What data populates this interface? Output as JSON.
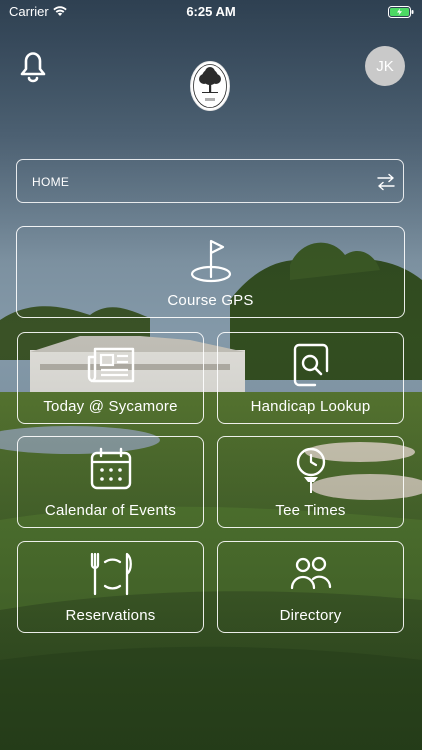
{
  "status_bar": {
    "carrier": "Carrier",
    "time": "6:25 AM"
  },
  "header": {
    "avatar_initials": "JK"
  },
  "selector": {
    "label": "HOME"
  },
  "tiles": {
    "course_gps": "Course GPS",
    "today": "Today @ Sycamore",
    "handicap": "Handicap Lookup",
    "calendar": "Calendar of Events",
    "tee_times": "Tee Times",
    "reservations": "Reservations",
    "directory": "Directory"
  },
  "colors": {
    "battery": "#4cd964",
    "avatar_bg": "#c9c9c9"
  }
}
